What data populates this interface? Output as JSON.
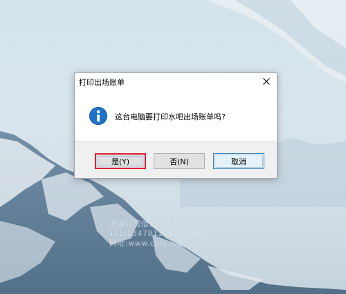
{
  "dialog": {
    "title": "打印出场账单",
    "message": "这台电脑要打印水吧出场账单吗?",
    "buttons": {
      "yes": "是(Y)",
      "no": "否(N)",
      "cancel": "取消"
    },
    "highlight_color": "#e01e2e"
  },
  "watermark": {
    "line1": "大连公需信息技术有限公司",
    "line2": "TEL:13478122141 曹先生",
    "line3": "网址:www.com.jsf.com"
  },
  "icons": {
    "message_icon": "info-icon",
    "close_icon": "close-icon"
  }
}
